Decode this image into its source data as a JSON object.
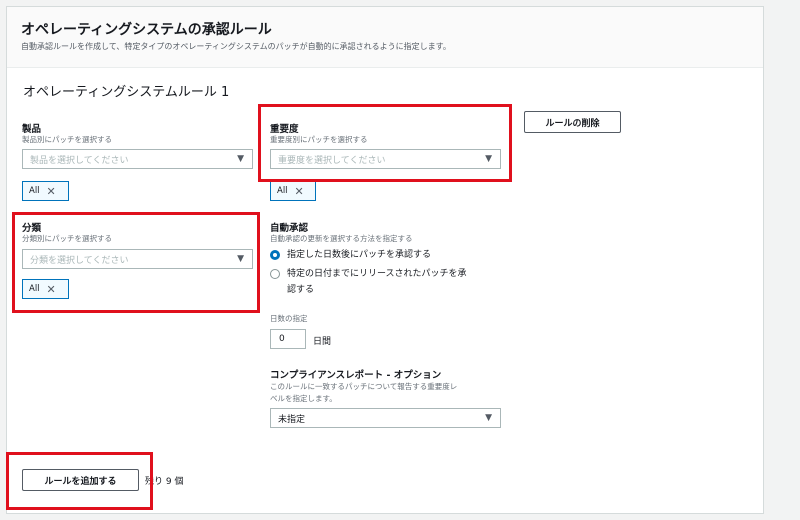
{
  "panel": {
    "title": "オペレーティングシステムの承認ルール",
    "description": "自動承認ルールを作成して、特定タイプのオペレーティングシステムのパッチが自動的に承認されるように指定します。"
  },
  "rule": {
    "title": "オペレーティングシステムルール 1",
    "delete_label": "ルールの削除"
  },
  "product": {
    "label": "製品",
    "hint": "製品別にパッチを選択する",
    "placeholder": "製品を選択してください",
    "token": "All"
  },
  "classification": {
    "label": "分類",
    "hint": "分類別にパッチを選択する",
    "placeholder": "分類を選択してください",
    "token": "All"
  },
  "severity": {
    "label": "重要度",
    "hint": "重要度別にパッチを選択する",
    "placeholder": "重要度を選択してください",
    "token": "All"
  },
  "auto_approval": {
    "label": "自動承認",
    "hint": "自動承認の更新を選択する方法を指定する",
    "options": [
      {
        "text": "指定した日数後にパッチを承認する",
        "checked": true
      },
      {
        "line1": "特定の日付までにリリースされたパッチを承",
        "line2": "認する",
        "checked": false
      }
    ],
    "days_label": "日数の指定",
    "days_value": "0",
    "days_unit": "日間"
  },
  "compliance": {
    "label": "コンプライアンスレポート - オプション",
    "hint_line1": "このルールに一致するパッチについて報告する重要度レ",
    "hint_line2": "ベルを指定します。",
    "value": "未指定"
  },
  "footer": {
    "add_rule_label": "ルールを追加する",
    "remaining": "残り 9 個"
  },
  "colors": {
    "highlight": "#e0101d",
    "accent": "#0073bb"
  },
  "icons": {
    "caret": "caret-down-icon",
    "remove": "remove-token-icon"
  }
}
